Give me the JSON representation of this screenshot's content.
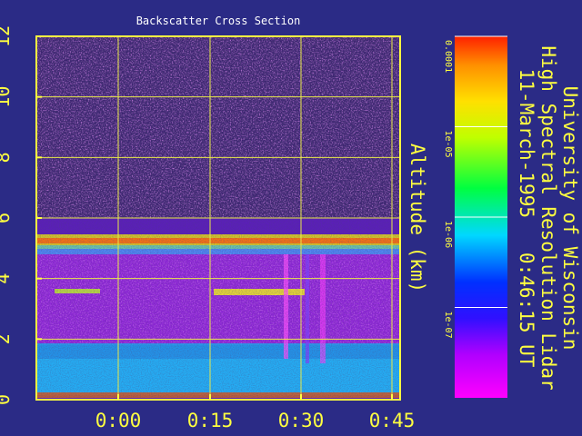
{
  "chart_data": {
    "type": "heatmap",
    "title": "Backscatter Cross Section",
    "ylabel": "Altitude (km)",
    "xlabel": "",
    "x_ticks": [
      "0:00",
      "0:15",
      "0:30",
      "0:45"
    ],
    "y_ticks": [
      "0",
      "2",
      "4",
      "6",
      "8",
      "10",
      "12"
    ],
    "ylim": [
      0,
      12
    ],
    "grid": true,
    "colorbar": {
      "ticks": [
        "0.0001",
        "1e-05",
        "1e-06",
        "1e-07"
      ],
      "scale": "log",
      "range": [
        1e-08,
        0.0001
      ],
      "colors": [
        "#ff00ff",
        "#8a00ff",
        "#1010ff",
        "#00e0ff",
        "#00ff40",
        "#ffff00",
        "#ffa000",
        "#ff2000"
      ]
    },
    "features": [
      {
        "name": "cloud layer",
        "altitude_km": 5.2
      },
      {
        "name": "aerosol layer",
        "altitude_km": 3.5
      },
      {
        "name": "boundary layer",
        "altitude_km": [
          0,
          1.8
        ]
      }
    ]
  },
  "side_title": {
    "line1": "University of Wisconsin",
    "line2": "High Spectral Resolution Lidar",
    "line3": "11-March-1995   0:46:15 UT"
  },
  "colors": {
    "background": "#2b2b86",
    "axis": "#ffff40",
    "title": "#ffffff",
    "grid": "#e8e84a"
  }
}
